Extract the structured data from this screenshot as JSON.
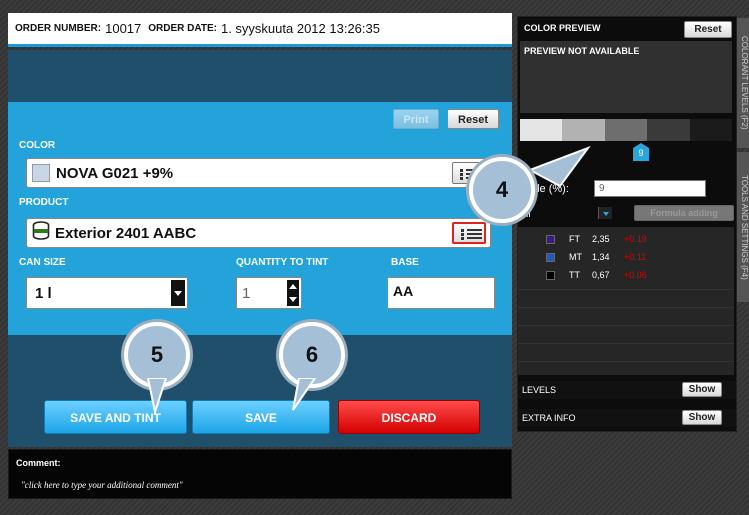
{
  "header": {
    "order_number_label": "ORDER NUMBER:",
    "order_number": "10017",
    "order_date_label": "ORDER DATE:",
    "order_date": "1. syyskuuta 2012 13:26:35"
  },
  "toolbar": {
    "print_label": "Print",
    "reset_label": "Reset"
  },
  "color": {
    "label": "COLOR",
    "value": "NOVA G021 +9%",
    "swatch_color": "#c7d7e6"
  },
  "product": {
    "label": "PRODUCT",
    "value": "Exterior 2401 AABC"
  },
  "can_size": {
    "label": "CAN SIZE",
    "value": "1 l"
  },
  "quantity": {
    "label": "QUANTITY TO TINT",
    "value": "1"
  },
  "base": {
    "label": "BASE",
    "value": "AA"
  },
  "actions": {
    "save_and_tint": "SAVE AND TINT",
    "save": "SAVE",
    "discard": "DISCARD"
  },
  "callouts": {
    "c4": "4",
    "c5": "5",
    "c6": "6"
  },
  "comment": {
    "label": "Comment:",
    "placeholder": "\"click here to type your additional comment\""
  },
  "preview": {
    "title": "COLOR PREVIEW",
    "reset_label": "Reset",
    "not_available": "PREVIEW NOT AVAILABLE",
    "marker_value": "9",
    "scale_label": "scale (%):",
    "scale_value": "9",
    "unit_label": "ml",
    "formula_button": "Formula adding",
    "colorants": [
      {
        "code": "FT",
        "amount": "2,35",
        "delta": "+0.19",
        "color": "#3a1a8c"
      },
      {
        "code": "MT",
        "amount": "1,34",
        "delta": "+0.11",
        "color": "#1e58c8"
      },
      {
        "code": "TT",
        "amount": "0,67",
        "delta": "+0.06",
        "color": "#000000"
      }
    ],
    "levels_label": "LEVELS",
    "levels_show": "Show",
    "extra_info_label": "EXTRA INFO",
    "extra_info_show": "Show",
    "tab_colorant_levels": "COLORANT LEVELS (F2)",
    "tab_tools_settings": "TOOLS AND SETTINGS (F4)"
  }
}
